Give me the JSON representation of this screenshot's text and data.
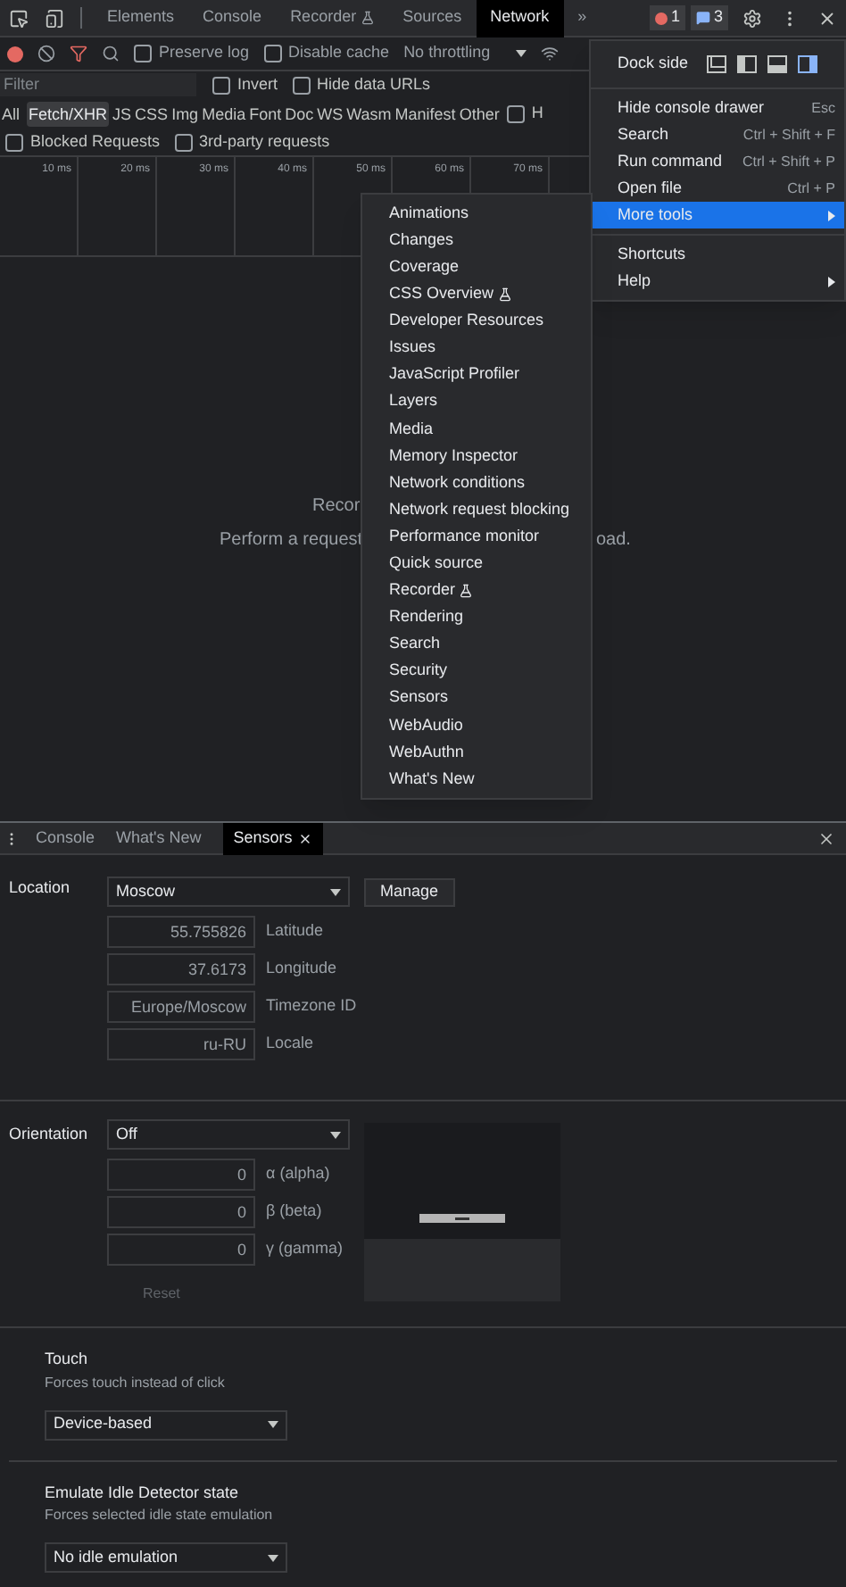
{
  "main_tabs": [
    {
      "label": "Elements",
      "selected": false,
      "experimental": false
    },
    {
      "label": "Console",
      "selected": false,
      "experimental": false
    },
    {
      "label": "Recorder",
      "selected": false,
      "experimental": true
    },
    {
      "label": "Sources",
      "selected": false,
      "experimental": false
    },
    {
      "label": "Network",
      "selected": true,
      "experimental": false
    },
    {
      "label": "»",
      "selected": false,
      "experimental": false
    }
  ],
  "badges": [
    {
      "kind": "error",
      "count": "1"
    },
    {
      "kind": "message",
      "count": "3"
    }
  ],
  "network_toolbar": {
    "checkboxes": [
      {
        "label": "Preserve log",
        "checked": false
      },
      {
        "label": "Disable cache",
        "checked": false
      }
    ],
    "throttling": "No throttling"
  },
  "filter": {
    "placeholder": "Filter",
    "checkboxes": [
      {
        "label": "Invert",
        "checked": false
      },
      {
        "label": "Hide data URLs",
        "checked": false
      }
    ]
  },
  "type_filters": [
    {
      "label": "All",
      "selected": false
    },
    {
      "label": "Fetch/XHR",
      "selected": true
    },
    {
      "label": "JS",
      "selected": false
    },
    {
      "label": "CSS",
      "selected": false
    },
    {
      "label": "Img",
      "selected": false
    },
    {
      "label": "Media",
      "selected": false
    },
    {
      "label": "Font",
      "selected": false
    },
    {
      "label": "Doc",
      "selected": false
    },
    {
      "label": "WS",
      "selected": false
    },
    {
      "label": "Wasm",
      "selected": false
    },
    {
      "label": "Manifest",
      "selected": false
    },
    {
      "label": "Other",
      "selected": false
    }
  ],
  "type_row_checkbox": {
    "label": "H",
    "checked": false
  },
  "request_checkboxes": [
    {
      "label": "Blocked Requests",
      "checked": false
    },
    {
      "label": "3rd-party requests",
      "checked": false
    }
  ],
  "timeline_ticks": [
    "10 ms",
    "20 ms",
    "30 ms",
    "40 ms",
    "50 ms",
    "60 ms",
    "70 ms"
  ],
  "empty_state": {
    "line_1": "Recor",
    "line_2_start": "Perform a request",
    "line_2_end": "oad."
  },
  "main_menu": {
    "dock_side": {
      "label": "Dock side",
      "options": [
        {
          "selected": false
        },
        {
          "selected": false
        },
        {
          "selected": false
        },
        {
          "selected": true
        }
      ]
    },
    "items": [
      {
        "kind": "separator"
      },
      {
        "kind": "item",
        "label": "Hide console drawer",
        "shortcut": "Esc",
        "submenu": false,
        "selected": false
      },
      {
        "kind": "item",
        "label": "Search",
        "shortcut": "Ctrl + Shift + F",
        "submenu": false,
        "selected": false
      },
      {
        "kind": "item",
        "label": "Run command",
        "shortcut": "Ctrl + Shift + P",
        "submenu": false,
        "selected": false
      },
      {
        "kind": "item",
        "label": "Open file",
        "shortcut": "Ctrl + P",
        "submenu": false,
        "selected": false
      },
      {
        "kind": "item",
        "label": "More tools",
        "submenu": true,
        "selected": true
      },
      {
        "kind": "separator"
      },
      {
        "kind": "item",
        "label": "Shortcuts",
        "submenu": false,
        "selected": false
      },
      {
        "kind": "item",
        "label": "Help",
        "submenu": true,
        "selected": false
      }
    ]
  },
  "more_tools_menu": [
    {
      "label": "Animations",
      "experimental": false
    },
    {
      "label": "Changes",
      "experimental": false
    },
    {
      "label": "Coverage",
      "experimental": false
    },
    {
      "label": "CSS Overview",
      "experimental": true
    },
    {
      "label": "Developer Resources",
      "experimental": false
    },
    {
      "label": "Issues",
      "experimental": false
    },
    {
      "label": "JavaScript Profiler",
      "experimental": false
    },
    {
      "label": "Layers",
      "experimental": false
    },
    {
      "label": "Media",
      "experimental": false
    },
    {
      "label": "Memory Inspector",
      "experimental": false
    },
    {
      "label": "Network conditions",
      "experimental": false
    },
    {
      "label": "Network request blocking",
      "experimental": false
    },
    {
      "label": "Performance monitor",
      "experimental": false
    },
    {
      "label": "Quick source",
      "experimental": false
    },
    {
      "label": "Recorder",
      "experimental": true
    },
    {
      "label": "Rendering",
      "experimental": false
    },
    {
      "label": "Search",
      "experimental": false
    },
    {
      "label": "Security",
      "experimental": false
    },
    {
      "label": "Sensors",
      "experimental": false
    },
    {
      "label": "WebAudio",
      "experimental": false
    },
    {
      "label": "WebAuthn",
      "experimental": false
    },
    {
      "label": "What's New",
      "experimental": false
    }
  ],
  "drawer_tabs": [
    {
      "label": "Console",
      "selected": false,
      "closable": false
    },
    {
      "label": "What's New",
      "selected": false,
      "closable": false
    },
    {
      "label": "Sensors",
      "selected": true,
      "closable": true
    }
  ],
  "sensors": {
    "location": {
      "label": "Location",
      "value": "Moscow",
      "manage": "Manage",
      "fields": [
        {
          "value": "55.755826",
          "label": "Latitude"
        },
        {
          "value": "37.6173",
          "label": "Longitude"
        },
        {
          "value": "Europe/Moscow",
          "label": "Timezone ID"
        },
        {
          "value": "ru-RU",
          "label": "Locale"
        }
      ]
    },
    "orientation": {
      "label": "Orientation",
      "value": "Off",
      "fields": [
        {
          "value": "0",
          "label": "α (alpha)"
        },
        {
          "value": "0",
          "label": "β (beta)"
        },
        {
          "value": "0",
          "label": "γ (gamma)"
        }
      ],
      "reset": "Reset",
      "reset_disabled": true
    },
    "sections": [
      {
        "title": "Touch",
        "description": "Forces touch instead of click",
        "value": "Device-based"
      },
      {
        "title": "Emulate Idle Detector state",
        "description": "Forces selected idle state emulation",
        "value": "No idle emulation"
      }
    ]
  }
}
